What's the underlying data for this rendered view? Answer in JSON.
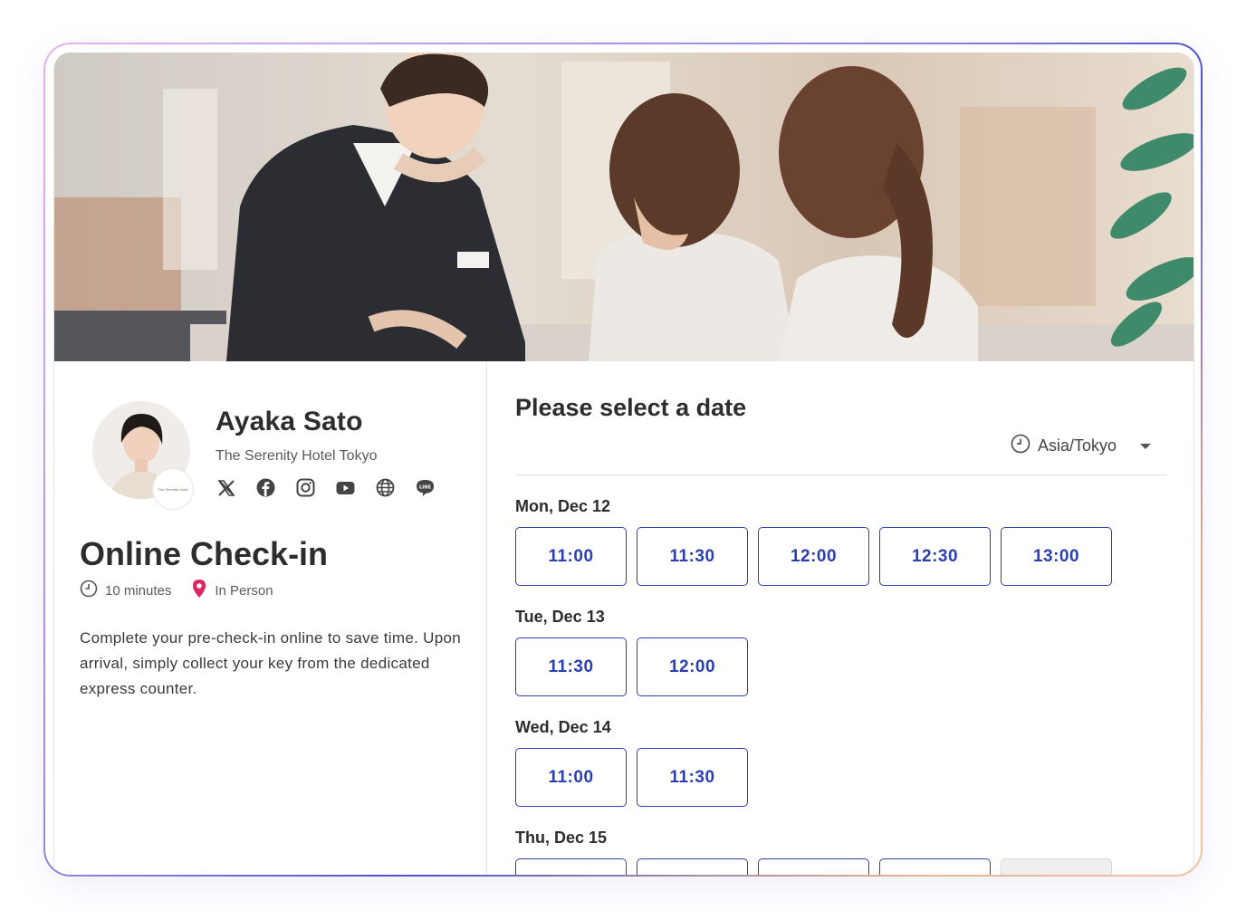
{
  "host": {
    "name": "Ayaka Sato",
    "organization": "The Serenity Hotel Tokyo",
    "badge_text": "The Serenity Hotel",
    "socials": [
      "x-icon",
      "facebook-icon",
      "instagram-icon",
      "youtube-icon",
      "globe-icon",
      "line-icon"
    ],
    "line_label": "LINE"
  },
  "event": {
    "title": "Online Check-in",
    "duration": "10 minutes",
    "location": "In Person",
    "description": "Complete your pre-check-in online to save time. Upon arrival, simply collect your key from the dedicated express counter."
  },
  "scheduler": {
    "heading": "Please select a date",
    "timezone": "Asia/Tokyo",
    "days": [
      {
        "label": "Mon, Dec 12",
        "slots": [
          "11:00",
          "11:30",
          "12:00",
          "12:30",
          "13:00"
        ]
      },
      {
        "label": "Tue, Dec 13",
        "slots": [
          "11:30",
          "12:00"
        ]
      },
      {
        "label": "Wed, Dec 14",
        "slots": [
          "11:00",
          "11:30"
        ]
      },
      {
        "label": "Thu, Dec 15",
        "slots": [
          "",
          "",
          "",
          "",
          ""
        ],
        "disabled_index": 4
      }
    ]
  },
  "colors": {
    "accent": "#2c3fb1",
    "location_pin": "#e0245e",
    "frame_gradient": [
      "#e6b3f0",
      "#8a7fe0",
      "#4a56c8",
      "#f0c49a"
    ]
  }
}
